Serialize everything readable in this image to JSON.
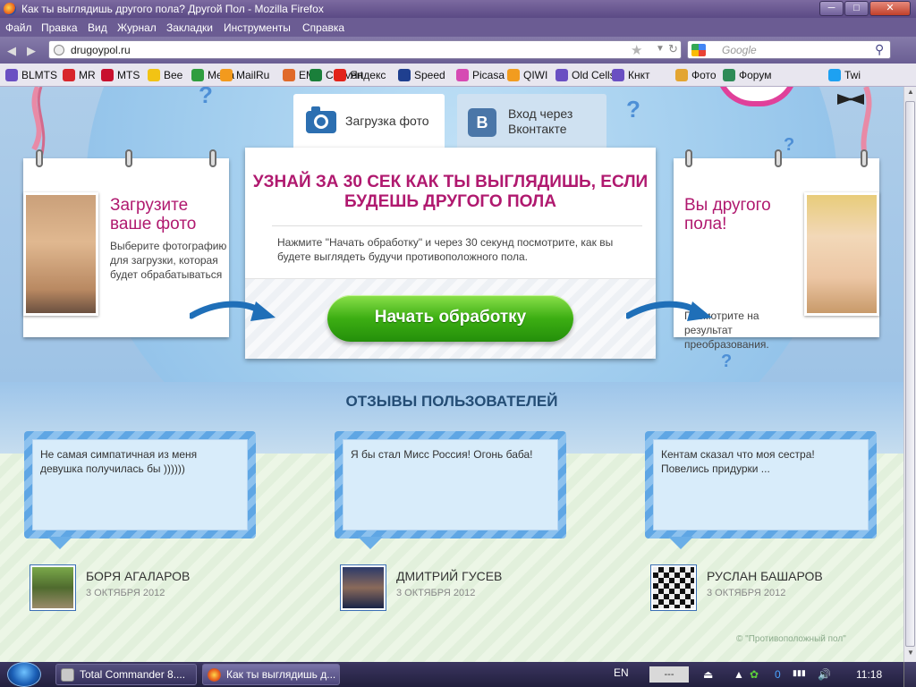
{
  "window": {
    "title": "Как ты выглядишь другого пола? Другой Пол - Mozilla Firefox",
    "min": "─",
    "max": "□",
    "close": "✕"
  },
  "menu": [
    "Файл",
    "Правка",
    "Вид",
    "Журнал",
    "Закладки",
    "Инструменты",
    "Справка"
  ],
  "nav": {
    "back": "◀",
    "forward": "▶",
    "url": "drugoypol.ru",
    "search_placeholder": "Google",
    "star": "★",
    "reload": "↻",
    "search_glyph": "⚲",
    "downloads_glyph": "⤓",
    "dropdown": "▼"
  },
  "bookmarks": [
    {
      "label": "BLMTS",
      "color": "#6a4fc2"
    },
    {
      "label": "MR",
      "color": "#d8262b"
    },
    {
      "label": "MTS",
      "color": "#c8102e"
    },
    {
      "label": "Bee",
      "color": "#f2c314"
    },
    {
      "label": "Mega",
      "color": "#2f9d3f"
    },
    {
      "label": "MailRu",
      "color": "#f39a1d"
    },
    {
      "label": "EM",
      "color": "#e06a2a"
    },
    {
      "label": "Convert",
      "color": "#1a7f3a"
    },
    {
      "label": "Яндекс",
      "color": "#e2231a"
    },
    {
      "label": "Speed",
      "color": "#1f3f8f"
    },
    {
      "label": "Picasa",
      "color": "#d64ab3"
    },
    {
      "label": "QIWI",
      "color": "#f29c1f"
    },
    {
      "label": "Old Cells",
      "color": "#6a4fc2"
    },
    {
      "label": "Кнкт",
      "color": "#6a4fc2"
    },
    {
      "label": "Фото",
      "color": "#e3a531"
    },
    {
      "label": "Форум",
      "color": "#2e8b57"
    },
    {
      "label": "Twi",
      "color": "#1da1f2"
    }
  ],
  "tabs": {
    "upload": "Загрузка фото",
    "vk_line1": "Вход через",
    "vk_line2": "Вконтакте",
    "vk_badge": "B"
  },
  "left_card": {
    "title": "Загрузите ваше фото",
    "text": "Выберите фотографию для загрузки, которая будет обрабатываться"
  },
  "right_card": {
    "title": "Вы другого пола!",
    "text": "Посмотрите на результат преобразования."
  },
  "center": {
    "headline": "УЗНАЙ ЗА 30 СЕК КАК ТЫ ВЫГЛЯДИШЬ, ЕСЛИ БУДЕШЬ ДРУГОГО ПОЛА",
    "text": "Нажмите \"Начать обработку\" и через 30 секунд посмотрите, как вы будете выглядеть будучи противоположного пола.",
    "button": "Начать обработку"
  },
  "reviews_title": "ОТЗЫВЫ ПОЛЬЗОВАТЕЛЕЙ",
  "reviews": [
    {
      "text": "Не самая симпатичная из меня девушка получилась бы ))))))",
      "name": "БОРЯ АГАЛАРОВ",
      "date": "3 ОКТЯБРЯ 2012"
    },
    {
      "text": "Я бы стал Мисс Россия! Огонь баба!",
      "name": "ДМИТРИЙ ГУСЕВ",
      "date": "3 ОКТЯБРЯ 2012"
    },
    {
      "text": "Кентам сказал что моя сестра! Повелись придурки ...",
      "name": "РУСЛАН БАШАРОВ",
      "date": "3 ОКТЯБРЯ 2012"
    }
  ],
  "copyright": "© \"Противоположный пол\"",
  "question_mark": "?",
  "taskbar": {
    "items": [
      "Total Commander 8....",
      "Как ты выглядишь д..."
    ],
    "lang": "EN",
    "tray_box": "---",
    "clock": "11:18",
    "tray_glyphs": [
      "▲",
      "✿",
      "0",
      "▮▮▮",
      "🔊"
    ]
  },
  "scroll": {
    "up": "▲",
    "down": "▼"
  }
}
